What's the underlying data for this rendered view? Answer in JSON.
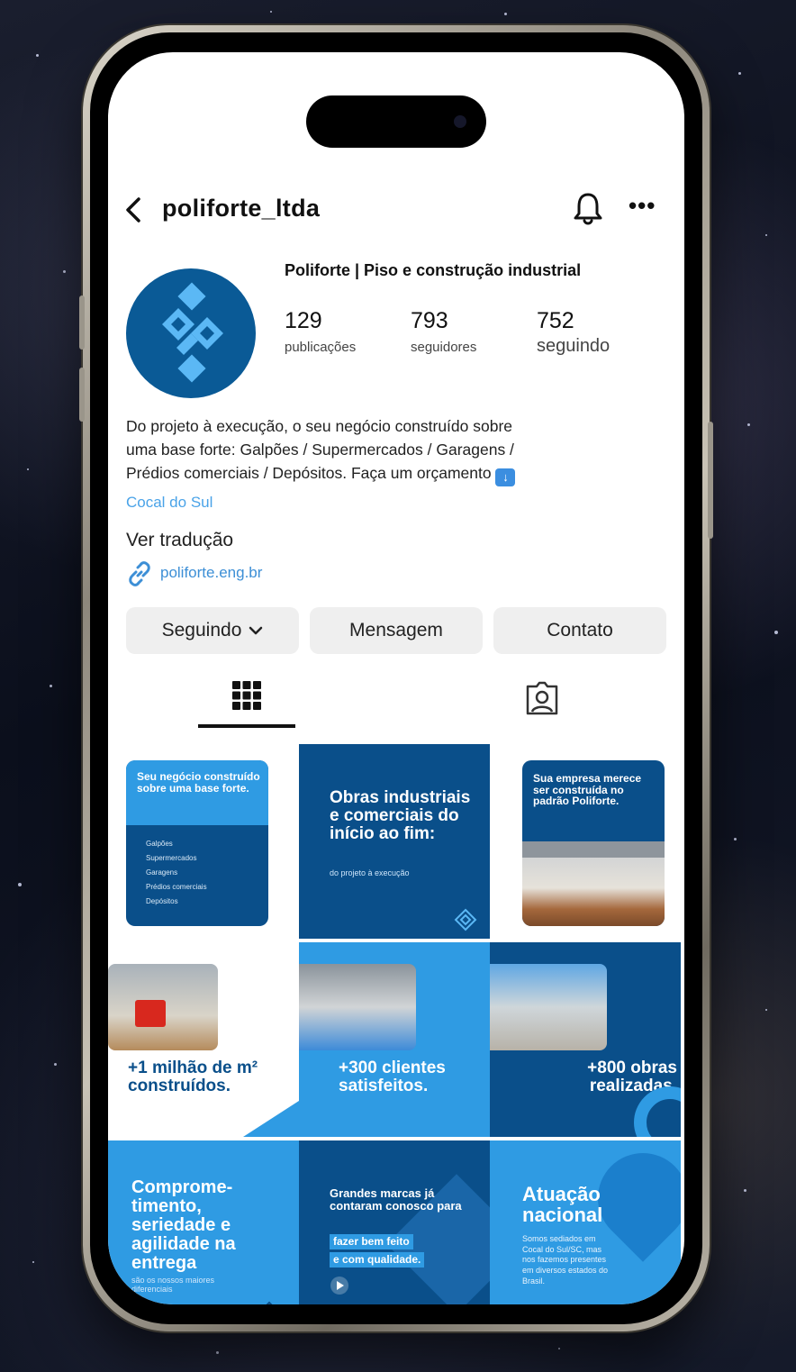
{
  "profile": {
    "username": "poliforte_ltda",
    "display_name": "Poliforte | Piso e construção industrial",
    "stats": [
      {
        "value": "129",
        "label": "publicações"
      },
      {
        "value": "793",
        "label": "seguidores"
      },
      {
        "value": "752",
        "label": "seguindo"
      }
    ],
    "bio_line1": "Do projeto à execução, o seu negócio construído sobre",
    "bio_line2": "uma base forte: Galpões / Supermercados / Garagens /",
    "bio_line3": "Prédios comerciais / Depósitos. Faça um orçamento",
    "location": "Cocal do Sul",
    "translate": "Ver tradução",
    "website": "poliforte.eng.br"
  },
  "buttons": {
    "following": "Seguindo",
    "message": "Mensagem",
    "contact": "Contato"
  },
  "posts": {
    "p1_title": "Seu negócio construído sobre uma base forte.",
    "p1_items": [
      "Galpões",
      "Supermercados",
      "Garagens",
      "Prédios comerciais",
      "Depósitos"
    ],
    "p2_title": "Obras industriais e comerciais do início ao fim:",
    "p2_sub": "do projeto à execução",
    "p3_title": "Sua empresa merece ser construída no padrão Poliforte.",
    "p4_title": "+1 milhão de m² construídos.",
    "p5_title": "+300 clientes satisfeitos.",
    "p6_title": "+800 obras realizadas.",
    "p7_title": "Comprome-timento, seriedade e agilidade na entrega",
    "p7_sub": "são os nossos maiores diferenciais",
    "p8_title": "Grandes marcas já contaram conosco para",
    "p8_highlight1": "fazer bem feito",
    "p8_highlight2": "e com qualidade.",
    "p9_title": "Atuação nacional",
    "p9_sub": "Somos sediados em Cocal do Sul/SC, mas nos fazemos presentes em diversos estados do Brasil."
  },
  "colors": {
    "brand_dark": "#0a4f8a",
    "brand_light": "#2f9be3",
    "link": "#3d8fd6"
  }
}
